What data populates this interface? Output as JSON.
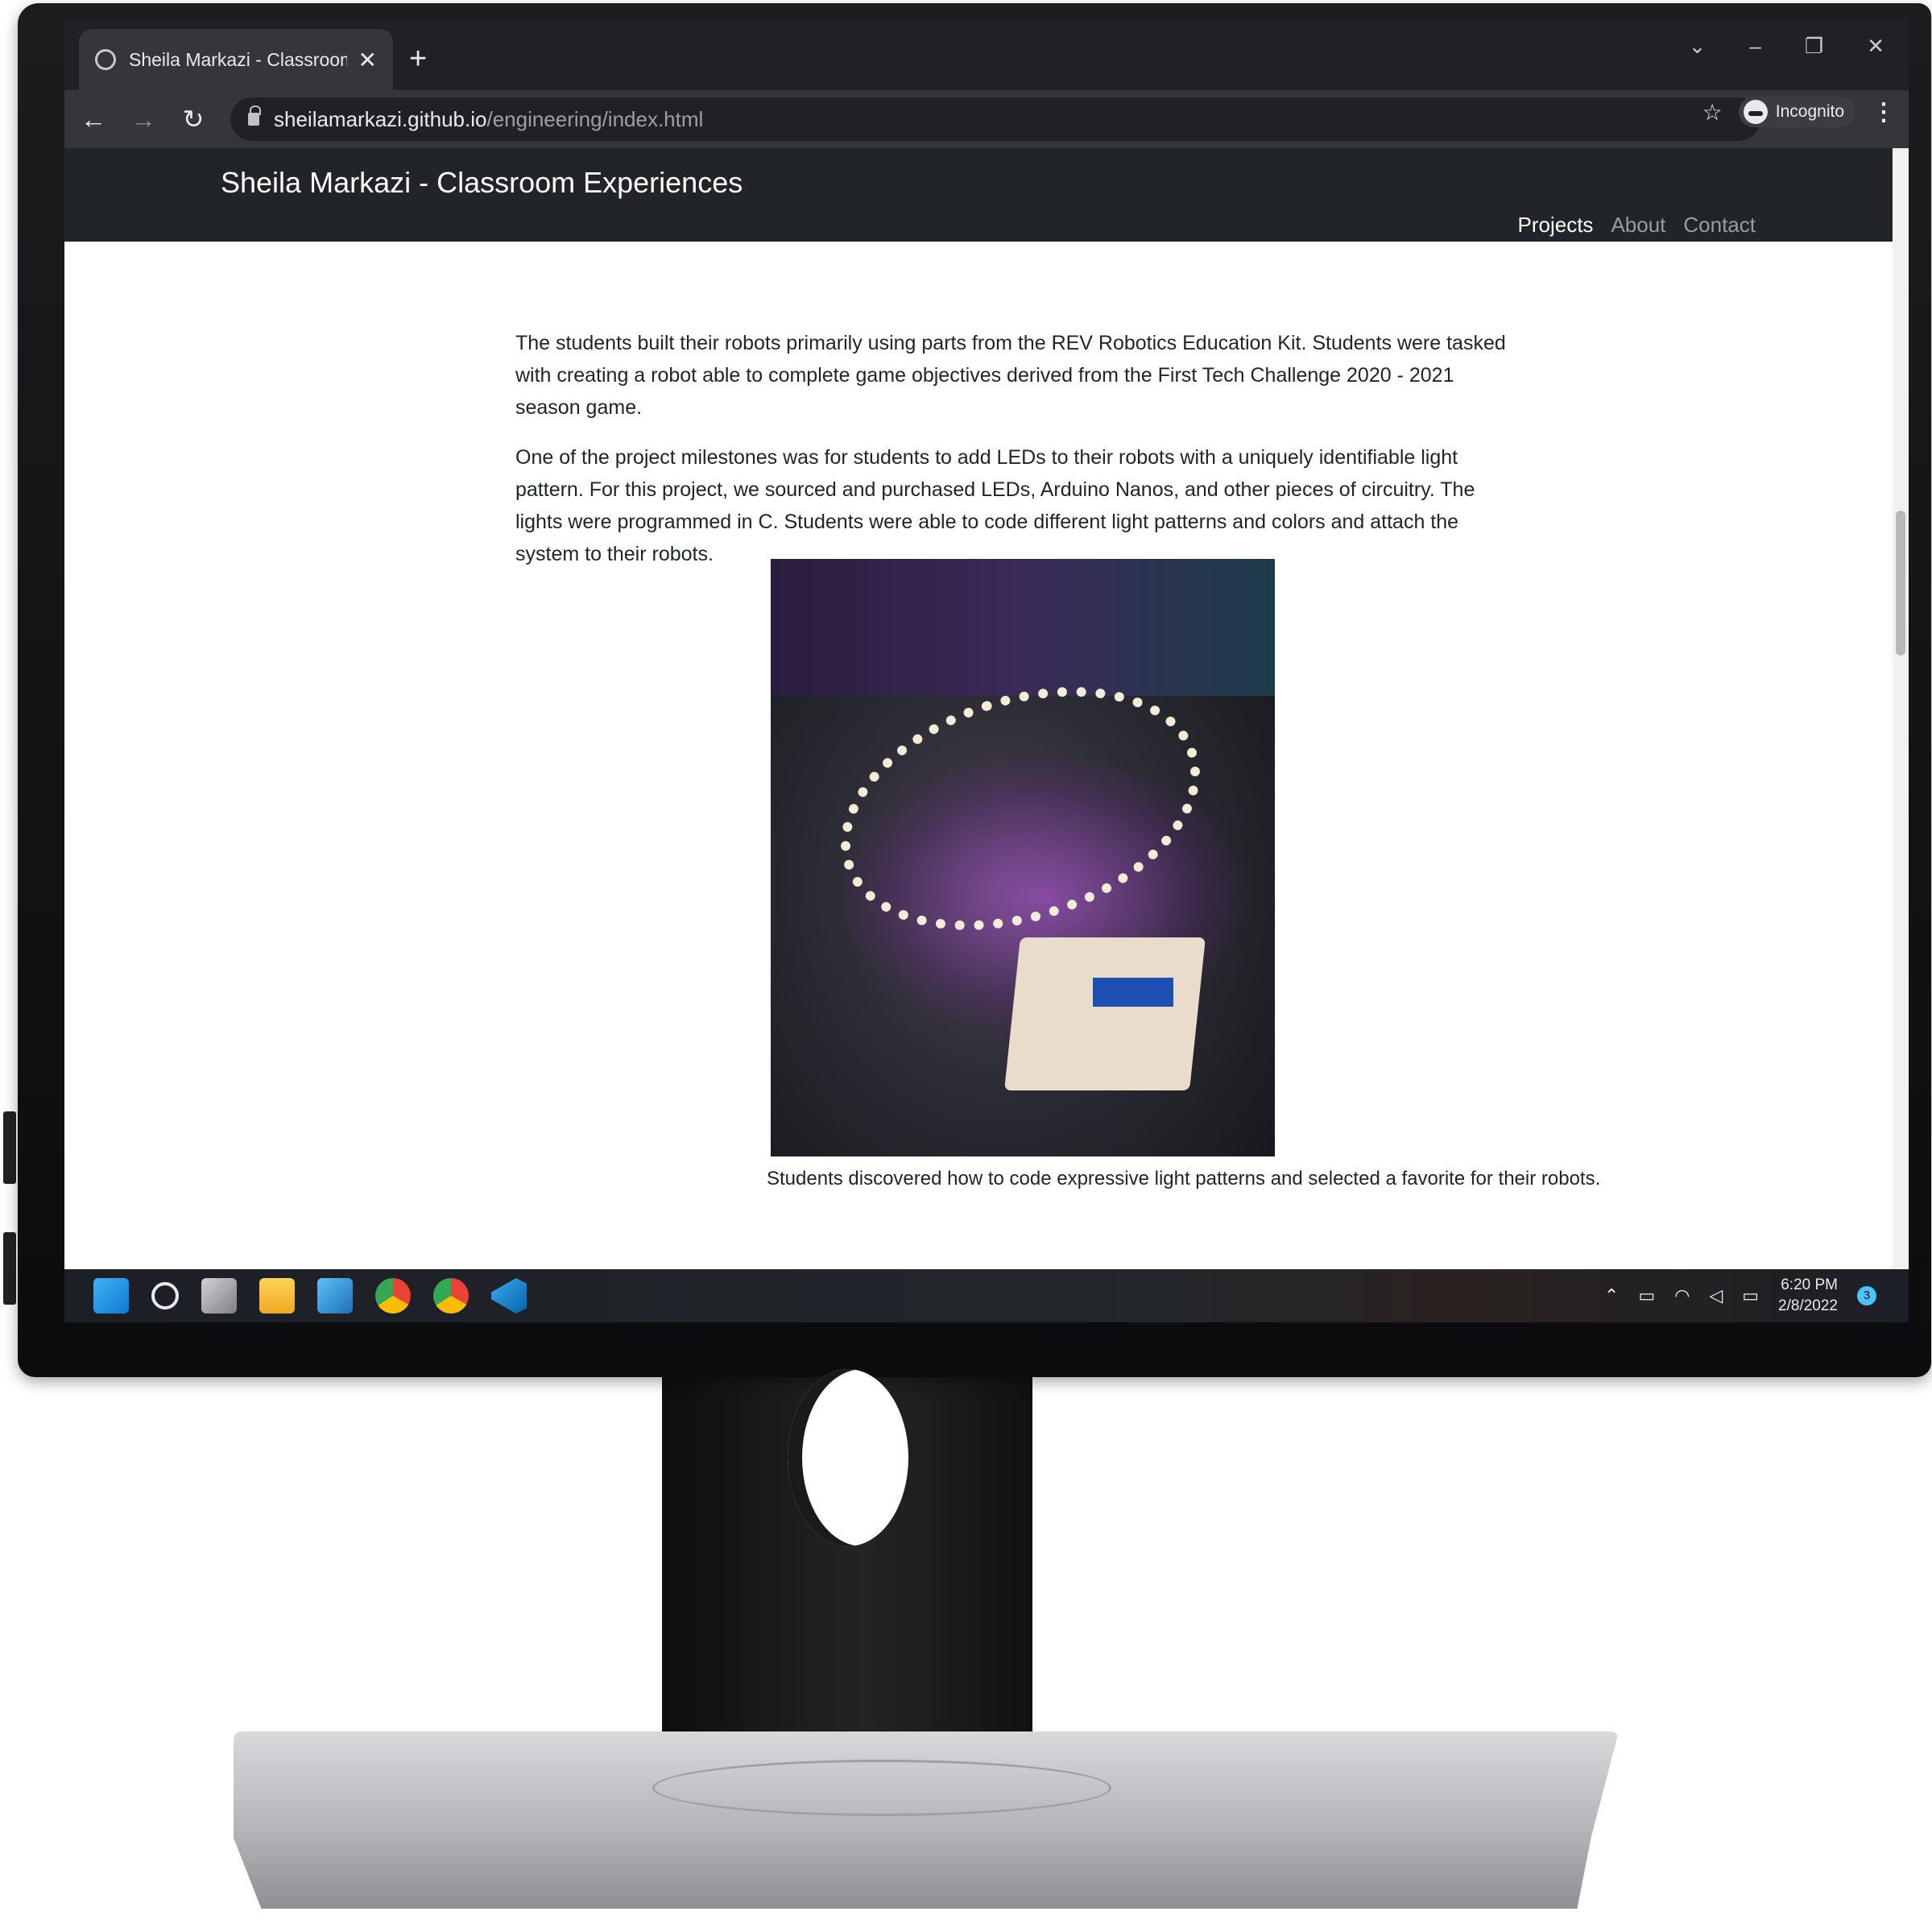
{
  "browser": {
    "tab_title": "Sheila Markazi - Classroom Exper",
    "new_tab": "+",
    "close_glyph": "✕",
    "url_host": "sheilamarkazi.github.io",
    "url_path": "/engineering/index.html",
    "incognito_label": "Incognito",
    "icons": [
      "back-arrow-icon",
      "forward-arrow-icon",
      "reload-icon",
      "lock-icon",
      "star-icon",
      "incognito-icon",
      "menu-icon"
    ]
  },
  "site": {
    "brand": "Sheila Markazi - Classroom Experiences",
    "nav": [
      {
        "label": "Projects",
        "active": true
      },
      {
        "label": "About",
        "active": false
      },
      {
        "label": "Contact",
        "active": false
      }
    ],
    "paragraphs": [
      "The students built their robots primarily using parts from the REV Robotics Education Kit. Students were tasked with creating a robot able to complete game objectives derived from the First Tech Challenge 2020 - 2021 season game.",
      "One of the project milestones was for students to add LEDs to their robots with a uniquely identifiable light pattern. For this project, we sourced and purchased LEDs, Arduino Nanos, and other pieces of circuitry. The lights were programmed in C. Students were able to code different light patterns and colors and attach the system to their robots."
    ],
    "figure_caption": "Students discovered how to code expressive light patterns and selected a favorite for their robots."
  },
  "taskbar": {
    "apps": [
      "start-icon",
      "search-icon",
      "task-view-icon",
      "file-explorer-icon",
      "photos-icon",
      "chrome-icon",
      "chrome-icon",
      "vscode-icon"
    ],
    "time": "6:20 PM",
    "date": "2/8/2022",
    "notifications": "3"
  },
  "colors": {
    "navbar": "#212529",
    "browser_chrome": "#35363a",
    "tab_strip": "#202124"
  }
}
